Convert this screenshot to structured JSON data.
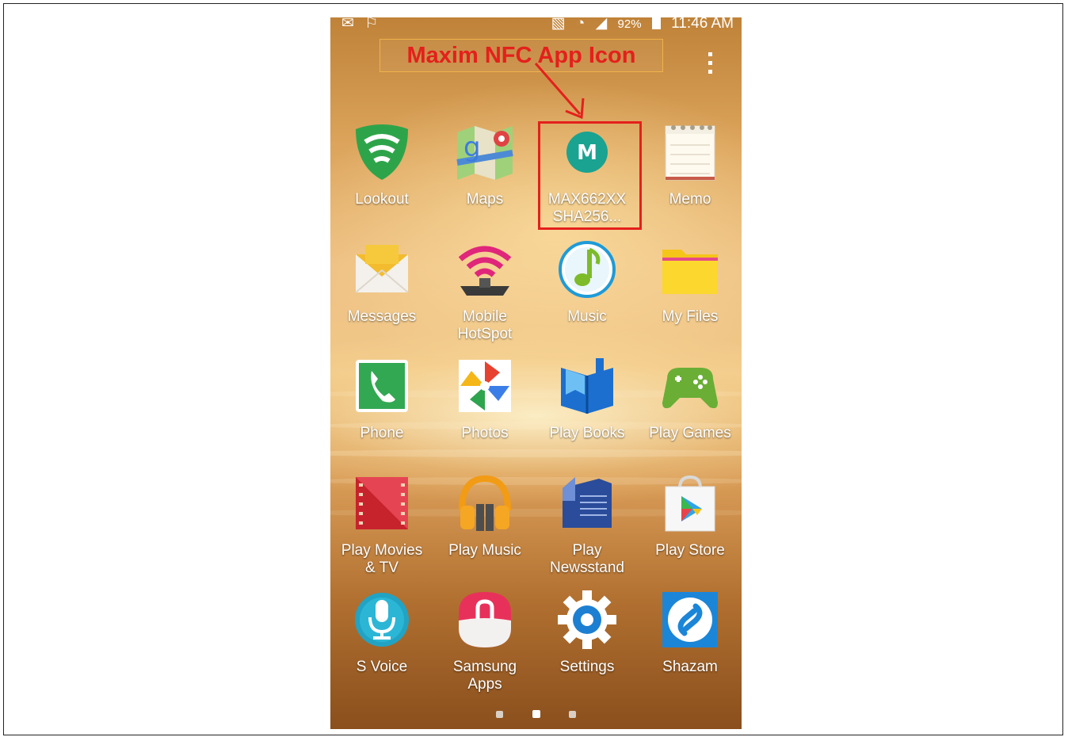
{
  "status_bar": {
    "battery": "92%",
    "time": "11:46 AM"
  },
  "callout": {
    "text": "Maxim NFC App Icon",
    "color": "#e4201c"
  },
  "apps": [
    {
      "label": "Lookout",
      "icon": "lookout-shield-icon"
    },
    {
      "label": "Maps",
      "icon": "maps-icon"
    },
    {
      "label": "MAX662XX\nSHA256...",
      "icon": "maxim-logo-icon"
    },
    {
      "label": "Memo",
      "icon": "memo-notepad-icon"
    },
    {
      "label": "Messages",
      "icon": "envelope-icon"
    },
    {
      "label": "Mobile\nHotSpot",
      "icon": "hotspot-wifi-icon"
    },
    {
      "label": "Music",
      "icon": "music-note-icon"
    },
    {
      "label": "My Files",
      "icon": "folder-icon"
    },
    {
      "label": "Phone",
      "icon": "phone-handset-icon"
    },
    {
      "label": "Photos",
      "icon": "pinwheel-icon"
    },
    {
      "label": "Play Books",
      "icon": "book-icon"
    },
    {
      "label": "Play Games",
      "icon": "gamepad-icon"
    },
    {
      "label": "Play Movies\n& TV",
      "icon": "film-strip-icon"
    },
    {
      "label": "Play Music",
      "icon": "headphones-icon"
    },
    {
      "label": "Play\nNewsstand",
      "icon": "newspaper-icon"
    },
    {
      "label": "Play Store",
      "icon": "shopping-bag-play-icon"
    },
    {
      "label": "S Voice",
      "icon": "microphone-icon"
    },
    {
      "label": "Samsung\nApps",
      "icon": "samsung-bag-icon"
    },
    {
      "label": "Settings",
      "icon": "gear-icon"
    },
    {
      "label": "Shazam",
      "icon": "shazam-s-icon"
    }
  ],
  "pager": {
    "pages": 3,
    "active_index": 1
  }
}
